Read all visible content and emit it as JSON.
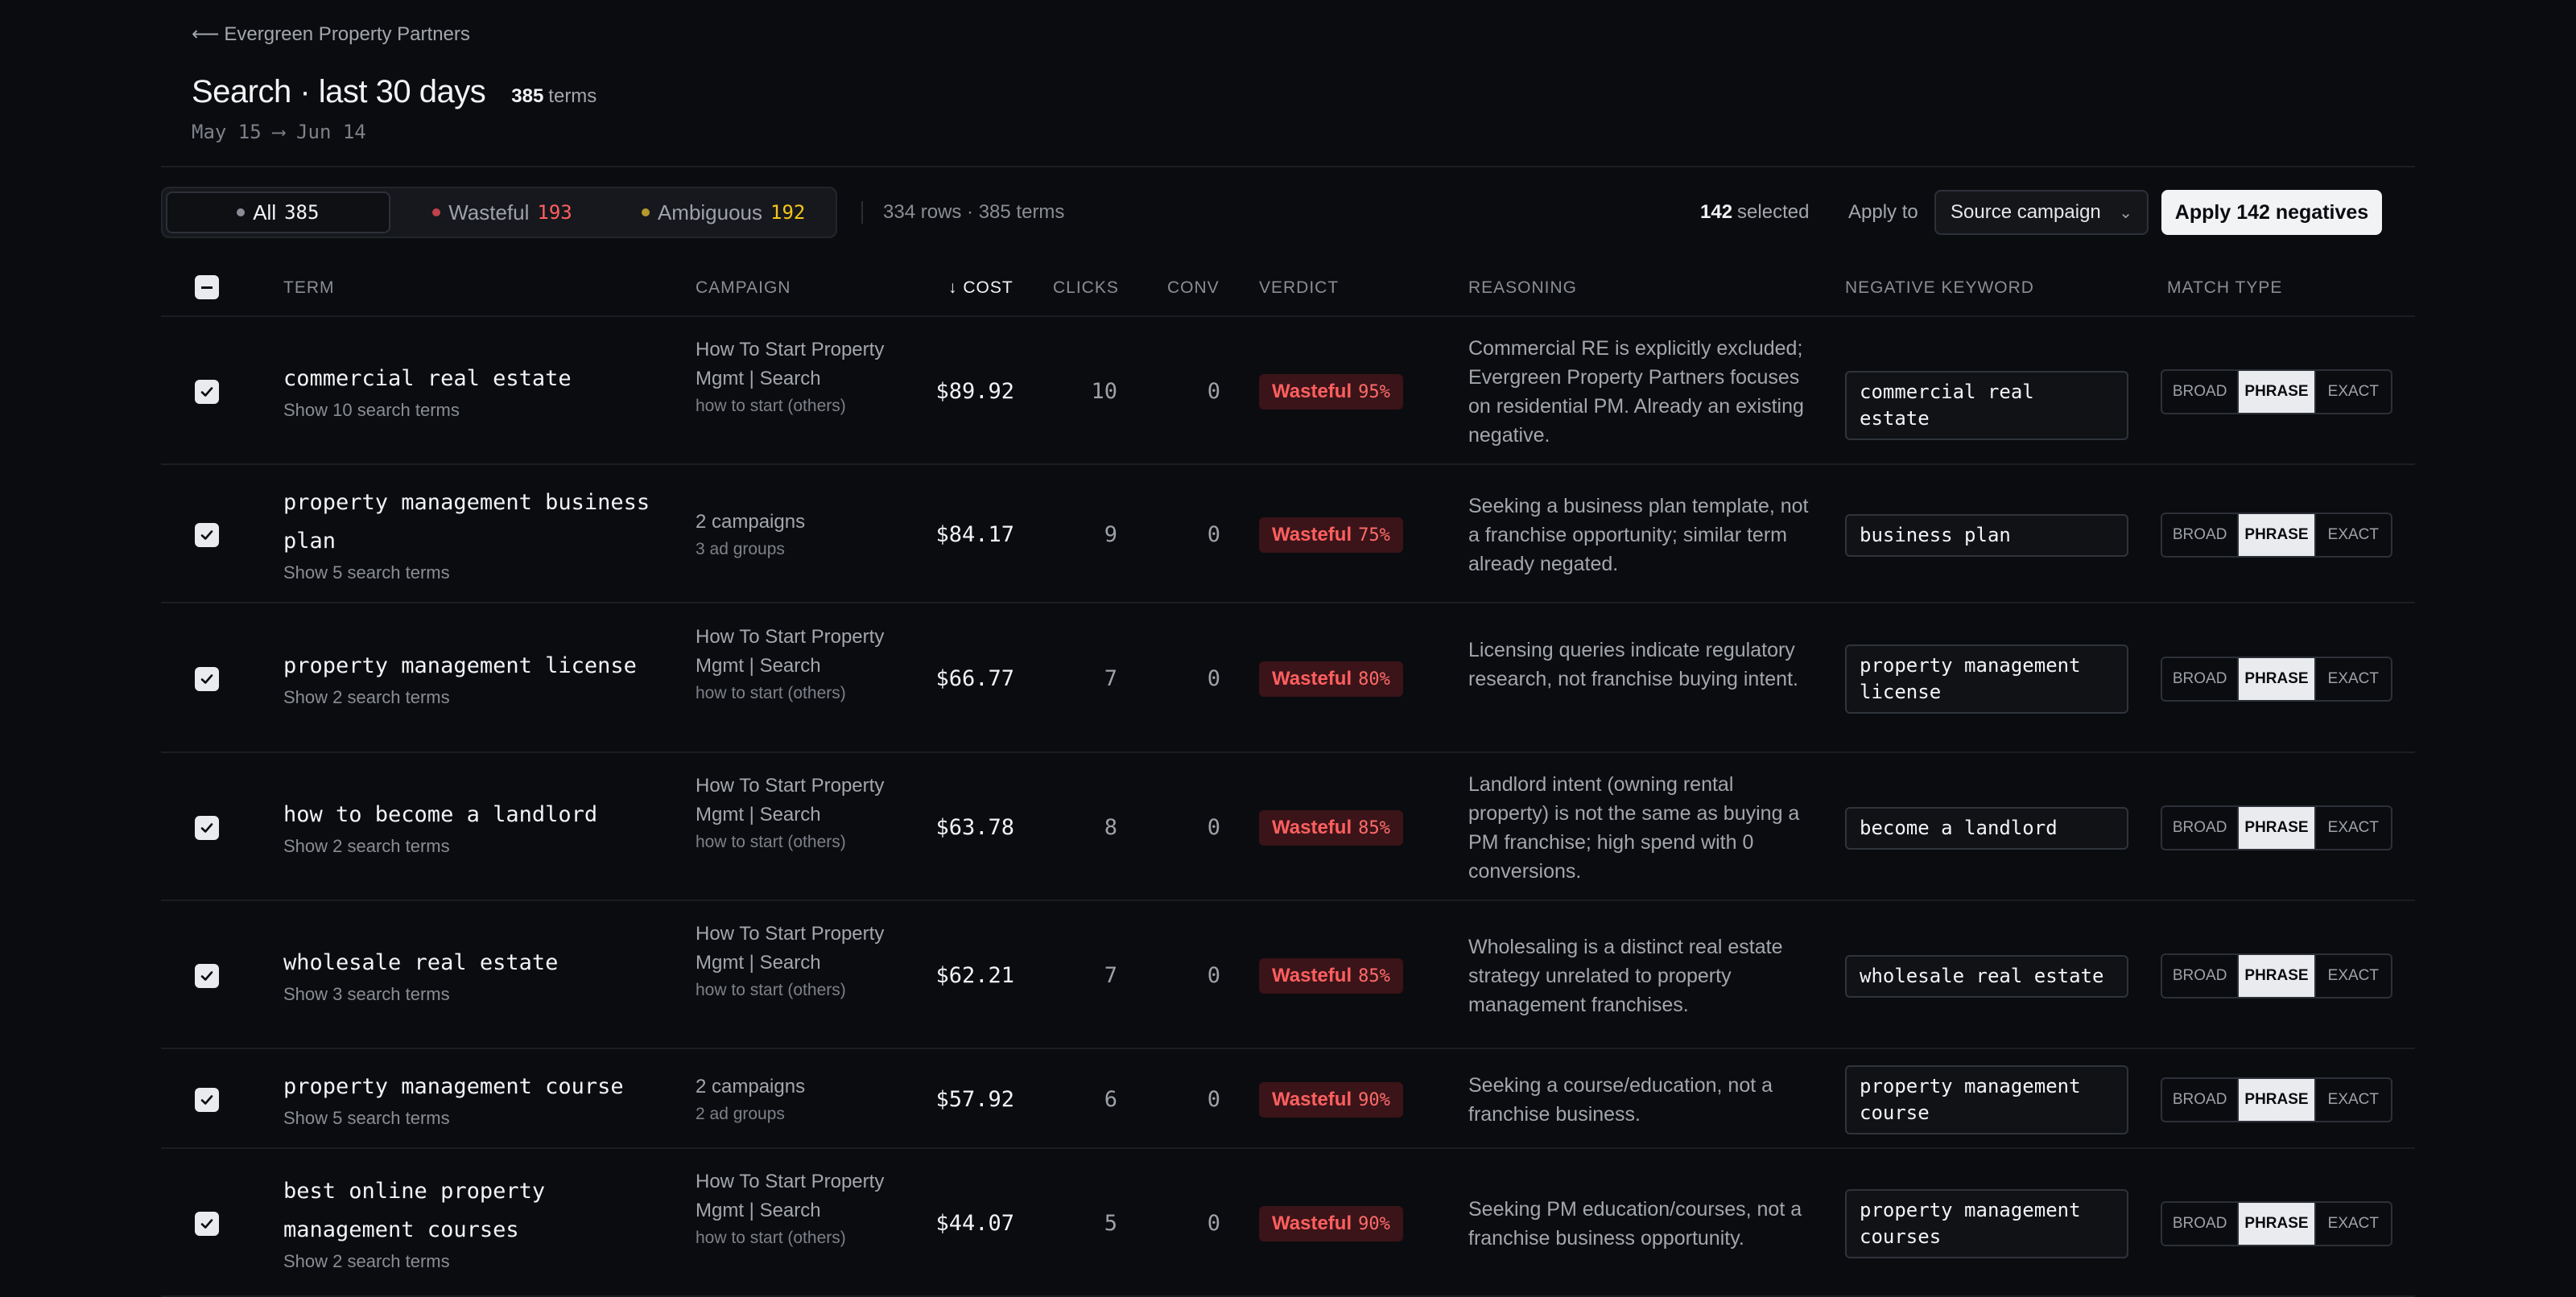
{
  "header": {
    "back_arrow": "⟵",
    "back_label": "Evergreen Property Partners",
    "title": "Search · last 30 days",
    "terms_count": "385",
    "terms_suffix": "terms",
    "date_range": "May 15 ⟶ Jun 14"
  },
  "filters": [
    {
      "label": "All",
      "count": "385",
      "dot_color": "#8a8d95",
      "count_color": "#f2f3f5",
      "active": true
    },
    {
      "label": "Wasteful",
      "count": "193",
      "dot_color": "#c0424a",
      "count_color": "#ff5f5f",
      "active": false
    },
    {
      "label": "Ambiguous",
      "count": "192",
      "dot_color": "#b59a2a",
      "count_color": "#f5c518",
      "active": false
    }
  ],
  "toolbar": {
    "rows_info": "334 rows · 385 terms",
    "selected_count": "142",
    "selected_label": "selected",
    "apply_to_label": "Apply to",
    "apply_to_value": "Source campaign",
    "apply_button": "Apply 142 negatives"
  },
  "columns": {
    "term": "TERM",
    "campaign": "CAMPAIGN",
    "cost": "↓ COST",
    "clicks": "CLICKS",
    "conv": "CONV",
    "verdict": "VERDICT",
    "reasoning": "REASONING",
    "negative_keyword": "NEGATIVE KEYWORD",
    "match_type": "MATCH TYPE"
  },
  "match_types": [
    "BROAD",
    "PHRASE",
    "EXACT"
  ],
  "rows": [
    {
      "term": "commercial real estate",
      "show_terms": "Show 10 search terms",
      "campaign": "How To Start Property Mgmt | Search",
      "campaign_sub": "how to start (others)",
      "cost": "$89.92",
      "clicks": "10",
      "conv": "0",
      "verdict": "Wasteful",
      "confidence": "95%",
      "reasoning": "Commercial RE is explicitly excluded; Evergreen Property Partners focuses on residential PM. Already an existing negative.",
      "negative_keyword": "commercial real estate",
      "match": "PHRASE",
      "checked": true
    },
    {
      "term": "property management business plan",
      "show_terms": "Show 5 search terms",
      "campaign": "2 campaigns",
      "campaign_sub": "3 ad groups",
      "cost": "$84.17",
      "clicks": "9",
      "conv": "0",
      "verdict": "Wasteful",
      "confidence": "75%",
      "reasoning": "Seeking a business plan template, not a franchise opportunity; similar term already negated.",
      "negative_keyword": "business plan",
      "match": "PHRASE",
      "checked": true
    },
    {
      "term": "property management license",
      "show_terms": "Show 2 search terms",
      "campaign": "How To Start Property Mgmt | Search",
      "campaign_sub": "how to start (others)",
      "cost": "$66.77",
      "clicks": "7",
      "conv": "0",
      "verdict": "Wasteful",
      "confidence": "80%",
      "reasoning": "Licensing queries indicate regulatory research, not franchise buying intent.",
      "negative_keyword": "property management license",
      "match": "PHRASE",
      "checked": true
    },
    {
      "term": "how to become a landlord",
      "show_terms": "Show 2 search terms",
      "campaign": "How To Start Property Mgmt | Search",
      "campaign_sub": "how to start (others)",
      "cost": "$63.78",
      "clicks": "8",
      "conv": "0",
      "verdict": "Wasteful",
      "confidence": "85%",
      "reasoning": "Landlord intent (owning rental property) is not the same as buying a PM franchise; high spend with 0 conversions.",
      "negative_keyword": "become a landlord",
      "match": "PHRASE",
      "checked": true
    },
    {
      "term": "wholesale real estate",
      "show_terms": "Show 3 search terms",
      "campaign": "How To Start Property Mgmt | Search",
      "campaign_sub": "how to start (others)",
      "cost": "$62.21",
      "clicks": "7",
      "conv": "0",
      "verdict": "Wasteful",
      "confidence": "85%",
      "reasoning": "Wholesaling is a distinct real estate strategy unrelated to property management franchises.",
      "negative_keyword": "wholesale real estate",
      "match": "PHRASE",
      "checked": true
    },
    {
      "term": "property management course",
      "show_terms": "Show 5 search terms",
      "campaign": "2 campaigns",
      "campaign_sub": "2 ad groups",
      "cost": "$57.92",
      "clicks": "6",
      "conv": "0",
      "verdict": "Wasteful",
      "confidence": "90%",
      "reasoning": "Seeking a course/education, not a franchise business.",
      "negative_keyword": "property management course",
      "match": "PHRASE",
      "checked": true
    },
    {
      "term": "best online property management courses",
      "show_terms": "Show 2 search terms",
      "campaign": "How To Start Property Mgmt | Search",
      "campaign_sub": "how to start (others)",
      "cost": "$44.07",
      "clicks": "5",
      "conv": "0",
      "verdict": "Wasteful",
      "confidence": "90%",
      "reasoning": "Seeking PM education/courses, not a franchise business opportunity.",
      "negative_keyword": "property management courses",
      "match": "PHRASE",
      "checked": true
    }
  ]
}
